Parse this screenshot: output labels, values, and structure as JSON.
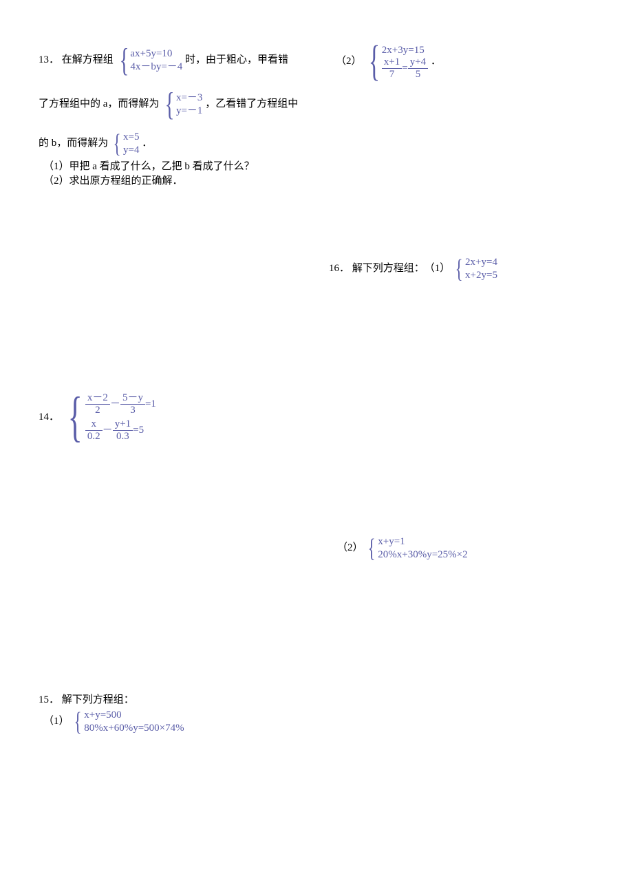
{
  "q13": {
    "num": "13．",
    "pre": "在解方程组",
    "sys1_l1": "ax+5y=10",
    "sys1_l2": "4x－by=－4",
    "mid1": "时，由于粗心，甲看错",
    "line2a": "了方程组中的 a，而得解为",
    "sys2_l1": "x=－3",
    "sys2_l2": "y=－1",
    "line2b": "，乙看错了方程组中",
    "line3a": "的 b，而得解为",
    "sys3_l1": "x=5",
    "sys3_l2": "y=4",
    "line3b": "．",
    "sub1": "（1）甲把 a 看成了什么，乙把 b 看成了什么？",
    "sub2": "（2）求出原方程组的正确解．"
  },
  "q14": {
    "num": "14．",
    "l1_f1n": "x－2",
    "l1_f1d": "2",
    "l1_f2n": "5－y",
    "l1_f2d": "3",
    "l1_eq": "=1",
    "l2_f1n": "x",
    "l2_f1d": "0.2",
    "l2_f2n": "y+1",
    "l2_f2d": "0.3",
    "l2_eq": "=5",
    "minus": "－"
  },
  "q15": {
    "num": "15．",
    "title": "解下列方程组：",
    "p1_label": "（1）",
    "p1_l1": "x+y=500",
    "p1_l2": "80%x+60%y=500×74%",
    "p2_label": "（2）",
    "p2_l1": "2x+3y=15",
    "p2_f1n": "x+1",
    "p2_f1d": "7",
    "p2_eq": "=",
    "p2_f2n": "y+4",
    "p2_f2d": "5",
    "p2_end": "．"
  },
  "q16": {
    "num": "16．",
    "title": "解下列方程组：",
    "p1_label": "（1）",
    "p1_l1": "2x+y=4",
    "p1_l2": "x+2y=5",
    "p2_label": "（2）",
    "p2_l1": "x+y=1",
    "p2_l2": "20%x+30%y=25%×2"
  }
}
